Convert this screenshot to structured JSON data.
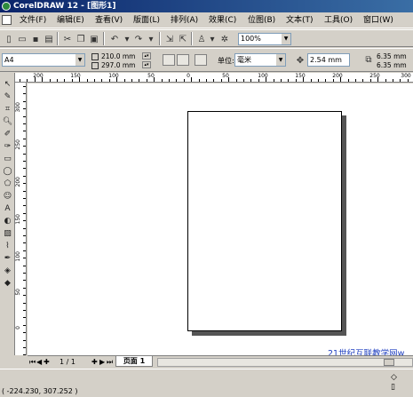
{
  "window": {
    "title": "CorelDRAW 12 - [图形1]"
  },
  "menu": [
    "文件(F)",
    "编辑(E)",
    "查看(V)",
    "版面(L)",
    "排列(A)",
    "效果(C)",
    "位图(B)",
    "文本(T)",
    "工具(O)",
    "窗口(W)"
  ],
  "toolbar": {
    "zoom": "100%"
  },
  "property_bar": {
    "paper": "A4",
    "width": "210.0 mm",
    "height": "297.0 mm",
    "unit_label": "单位:",
    "unit": "毫米",
    "nudge": "2.54 mm",
    "dup_x": "6.35 mm",
    "dup_y": "6.35 mm"
  },
  "ruler": {
    "h_labels": [
      "200",
      "150",
      "100",
      "50",
      "0",
      "50",
      "100",
      "150",
      "200",
      "250",
      "300"
    ],
    "v_labels": [
      "300",
      "250",
      "200",
      "150",
      "100",
      "50",
      "0"
    ]
  },
  "page_nav": {
    "counter": "1 / 1",
    "tab": "页面 1"
  },
  "watermark": "21世纪互联教学网w",
  "status": {
    "coords": "( -224.230, 307.252 )"
  },
  "icons": {
    "pointer": "pointer-icon",
    "shape": "shape-tool-icon",
    "zoom": "zoom-icon",
    "freehand": "freehand-icon",
    "rectangle": "rectangle-icon",
    "ellipse": "ellipse-icon",
    "text": "text-tool-icon",
    "fill": "fill-icon"
  }
}
